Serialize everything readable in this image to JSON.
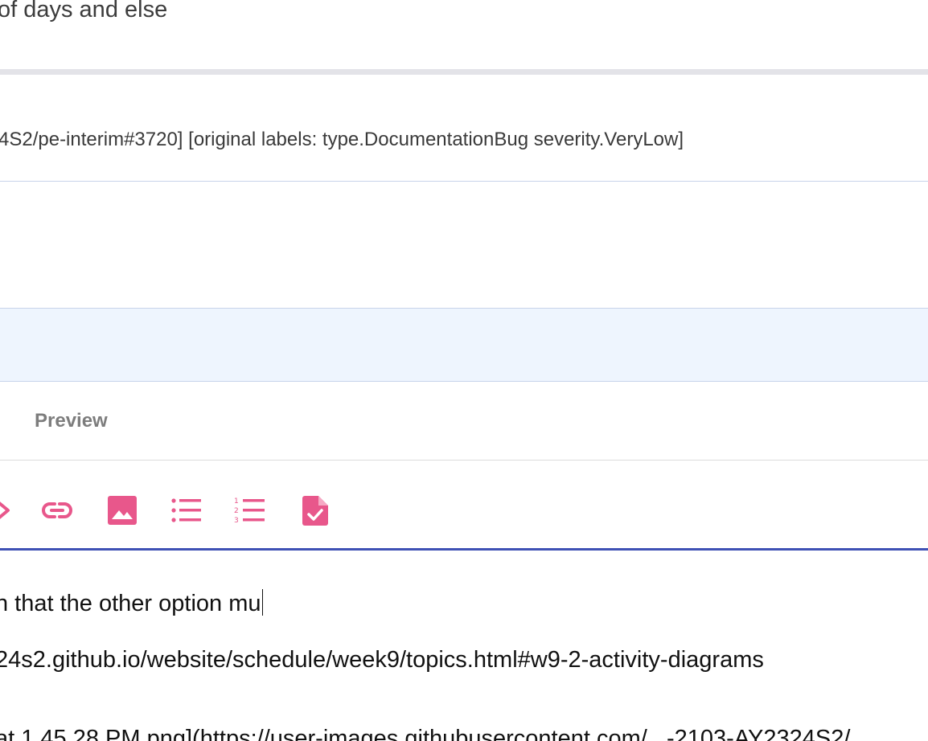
{
  "description_text": "of days and else",
  "original_labels_text": "4S2/pe-interim#3720] [original labels: type.DocumentationBug severity.VeryLow]",
  "tabs": {
    "preview_label": "Preview"
  },
  "toolbar": {
    "icons": [
      "code-icon",
      "link-icon",
      "image-icon",
      "bulleted-list-icon",
      "numbered-list-icon",
      "task-list-icon"
    ],
    "accent_color": "#e8578b"
  },
  "editor": {
    "line1": "n that the other option mu",
    "line2": "24s2.github.io/website/schedule/week9/topics.html#w9-2-activity-diagrams",
    "line3": "at 1.45.28 PM.png](https://user-images.githubusercontent.com/...-2103-AY2324S2/"
  },
  "colors": {
    "accent": "#e8578b",
    "editor_underline": "#3f51b5",
    "highlight_band": "#eef5fe"
  }
}
